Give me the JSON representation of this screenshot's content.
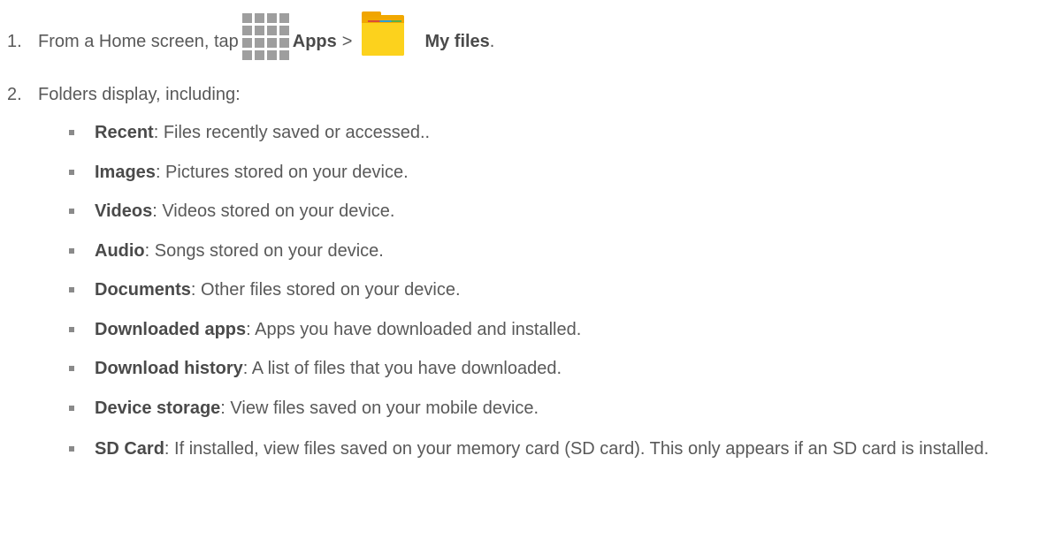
{
  "steps": [
    {
      "number": "1.",
      "text_before": "From a Home screen, tap",
      "apps_label": "Apps",
      "separator": ">",
      "files_label": "My files",
      "end": "."
    },
    {
      "number": "2.",
      "text": "Folders display, including:"
    }
  ],
  "folders": [
    {
      "name": "Recent",
      "desc": ": Files recently saved or accessed.."
    },
    {
      "name": "Images",
      "desc": ": Pictures stored on your device."
    },
    {
      "name": "Videos",
      "desc": ": Videos stored on your device."
    },
    {
      "name": "Audio",
      "desc": ": Songs stored on your device."
    },
    {
      "name": "Documents",
      "desc": ": Other files stored on your device."
    },
    {
      "name": "Downloaded apps",
      "desc": ": Apps you have downloaded and installed."
    },
    {
      "name": "Download history",
      "desc": ": A list of files that you have downloaded."
    },
    {
      "name": "Device storage",
      "desc": ": View files saved on your mobile device."
    },
    {
      "name": "SD Card",
      "desc": ": If installed, view files saved on your memory card (SD card). This only appears if an SD card is installed."
    }
  ],
  "icons": {
    "apps": "apps-grid-icon",
    "files": "my-files-folder-icon",
    "bullet": "square-bullet-icon"
  },
  "colors": {
    "text": "#595959",
    "apps_icon": "#9e9e9e",
    "folder_front": "#fcd21d",
    "folder_back": "#f1a800"
  }
}
